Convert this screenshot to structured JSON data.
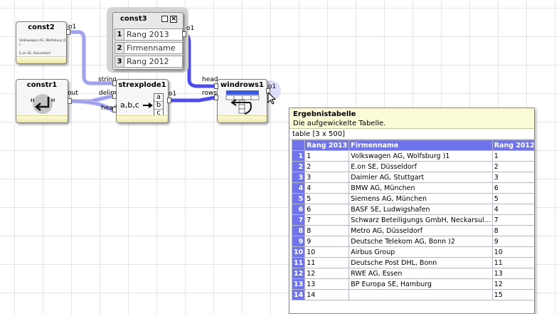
{
  "nodes": {
    "const2": {
      "title": "const2",
      "out_port": "o1",
      "text_line1": "Volkswagen AG, Wolfsburg )1",
      "text_line2": ")",
      "text_line3": "E.on SE, Düsseldorf"
    },
    "constr1": {
      "title": "constr1",
      "out_port": "out"
    },
    "const3": {
      "title": "const3",
      "out_port": "o1",
      "rows": [
        {
          "n": "1",
          "v": "Rang 2013"
        },
        {
          "n": "2",
          "v": "Firmenname"
        },
        {
          "n": "3",
          "v": "Rang 2012"
        }
      ]
    },
    "strexplode1": {
      "title": "strexplode1",
      "in_ports": [
        "string",
        "delim",
        "head"
      ],
      "out_port": "o1",
      "icon_text": "a,b,c",
      "letters": [
        "a",
        "b",
        "c"
      ]
    },
    "windrows1": {
      "title": "windrows1",
      "in_ports": [
        "head",
        "rows"
      ],
      "out_port": "o1"
    }
  },
  "colors": {
    "wire": "#5a5ae8",
    "wire_light": "#c8c8f4",
    "header": "#6f74ec",
    "popup_bg": "#fcfbd9"
  },
  "popup": {
    "title": "Ergebnistabelle",
    "description": "Die aufgewickelte Tabelle.",
    "info": "table [3 x 500]",
    "columns": [
      "Rang 2013",
      "Firmenname",
      "Rang 2012"
    ],
    "rows": [
      {
        "idx": "1",
        "rang2013": "1",
        "name": "Volkswagen AG, Wolfsburg )1",
        "rang2012": "1"
      },
      {
        "idx": "2",
        "rang2013": "2",
        "name": "E.on SE, Düsseldorf",
        "rang2012": "2"
      },
      {
        "idx": "3",
        "rang2013": "3",
        "name": "Daimler AG, Stuttgart",
        "rang2012": "3"
      },
      {
        "idx": "4",
        "rang2013": "4",
        "name": "BMW AG, München",
        "rang2012": "6"
      },
      {
        "idx": "5",
        "rang2013": "5",
        "name": "Siemens AG, München",
        "rang2012": "5"
      },
      {
        "idx": "6",
        "rang2013": "6",
        "name": "BASF SE, Ludwigshafen",
        "rang2012": "4"
      },
      {
        "idx": "7",
        "rang2013": "7",
        "name": "Schwarz Beteiligungs GmbH, Neckarsul...",
        "rang2012": "7"
      },
      {
        "idx": "8",
        "rang2013": "8",
        "name": "Metro AG, Düsseldorf",
        "rang2012": "8"
      },
      {
        "idx": "9",
        "rang2013": "9",
        "name": "Deutsche Telekom AG, Bonn )2",
        "rang2012": "9"
      },
      {
        "idx": "10",
        "rang2013": "10",
        "name": "Airbus Group",
        "rang2012": "10"
      },
      {
        "idx": "11",
        "rang2013": "11",
        "name": "Deutsche Post DHL, Bonn",
        "rang2012": "11"
      },
      {
        "idx": "12",
        "rang2013": "12",
        "name": "RWE AG, Essen",
        "rang2012": "13"
      },
      {
        "idx": "13",
        "rang2013": "13",
        "name": "BP Europa SE, Hamburg",
        "rang2012": "12"
      },
      {
        "idx": "14",
        "rang2013": "14",
        "name": "",
        "rang2012": "15"
      }
    ]
  }
}
